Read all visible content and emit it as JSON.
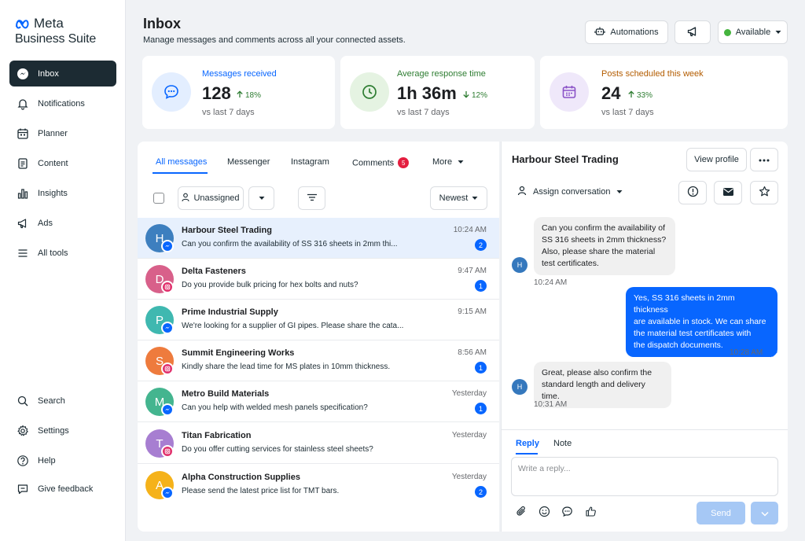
{
  "brand": {
    "meta": "Meta",
    "suite": "Business Suite"
  },
  "sidebar": {
    "items": [
      {
        "label": "Inbox",
        "icon": "messenger-icon"
      },
      {
        "label": "Notifications",
        "icon": "bell-icon"
      },
      {
        "label": "Planner",
        "icon": "calendar-icon"
      },
      {
        "label": "Content",
        "icon": "document-icon"
      },
      {
        "label": "Insights",
        "icon": "bar-chart-icon"
      },
      {
        "label": "Ads",
        "icon": "megaphone-icon"
      },
      {
        "label": "All tools",
        "icon": "menu-icon"
      }
    ],
    "bottom": [
      {
        "label": "Search",
        "icon": "search-icon"
      },
      {
        "label": "Settings",
        "icon": "gear-icon"
      },
      {
        "label": "Help",
        "icon": "help-icon"
      },
      {
        "label": "Give feedback",
        "icon": "feedback-icon"
      }
    ]
  },
  "header": {
    "title": "Inbox",
    "subtitle": "Manage messages and comments across all your connected assets.",
    "automations": "Automations",
    "status": "Available"
  },
  "stats": [
    {
      "label": "Messages received",
      "value": "128",
      "change": "18%",
      "direction": "up",
      "foot": "vs last 7 days",
      "color": "#0866ff"
    },
    {
      "label": "Average response time",
      "value": "1h 36m",
      "change": "12%",
      "direction": "down",
      "foot": "vs last 7 days",
      "color": "#2e7d32"
    },
    {
      "label": "Posts scheduled this week",
      "value": "24",
      "change": "33%",
      "direction": "up",
      "foot": "vs last 7 days",
      "color": "#b35c00"
    }
  ],
  "list": {
    "tabs": [
      "All messages",
      "Messenger",
      "Instagram",
      "Comments",
      "More"
    ],
    "comments_count": "5",
    "unassigned": "Unassigned",
    "sort": "Newest",
    "rows": [
      {
        "initial": "H",
        "name": "Harbour Steel Trading",
        "preview": "Can you confirm the availability of SS 316 sheets in 2mm thi...",
        "time": "10:24 AM",
        "count": "2",
        "channel": "messenger",
        "color": "#3d7fbf"
      },
      {
        "initial": "D",
        "name": "Delta Fasteners",
        "preview": "Do you provide bulk pricing for hex bolts and nuts?",
        "time": "9:47 AM",
        "count": "1",
        "channel": "instagram",
        "color": "#d8608a"
      },
      {
        "initial": "P",
        "name": "Prime Industrial Supply",
        "preview": "We're looking for a supplier of GI pipes. Please share the cata...",
        "time": "9:15 AM",
        "count": "",
        "channel": "messenger",
        "color": "#3fb8b0"
      },
      {
        "initial": "S",
        "name": "Summit Engineering Works",
        "preview": "Kindly share the lead time for MS plates in 10mm thickness.",
        "time": "8:56 AM",
        "count": "1",
        "channel": "instagram",
        "color": "#ee7b3d"
      },
      {
        "initial": "M",
        "name": "Metro Build Materials",
        "preview": "Can you help with welded mesh panels specification?",
        "time": "Yesterday",
        "count": "1",
        "channel": "messenger",
        "color": "#44b58f"
      },
      {
        "initial": "T",
        "name": "Titan Fabrication",
        "preview": "Do you offer cutting services for stainless steel sheets?",
        "time": "Yesterday",
        "count": "",
        "channel": "instagram",
        "color": "#a77ed1"
      },
      {
        "initial": "A",
        "name": "Alpha Construction Supplies",
        "preview": "Please send the latest price list for TMT bars.",
        "time": "Yesterday",
        "count": "2",
        "channel": "messenger",
        "color": "#f5b21a"
      }
    ]
  },
  "conversation": {
    "title": "Harbour Steel Trading",
    "view_profile": "View profile",
    "assign": "Assign conversation",
    "messages": [
      {
        "from": "in",
        "lines": [
          "Can you confirm the availability of",
          "SS 316 sheets in 2mm thickness?",
          "Also, please share the material",
          "test certificates."
        ],
        "time": "10:24 AM"
      },
      {
        "from": "out",
        "lines": [
          "Yes, SS 316 sheets in 2mm thickness",
          "are available in stock. We can share",
          "the material test certificates with",
          "the dispatch documents."
        ],
        "time": "10:28 AM"
      },
      {
        "from": "in",
        "lines": [
          "Great, please also confirm the",
          "standard length and delivery time."
        ],
        "time": "10:31 AM"
      }
    ],
    "avatar_initial": "H",
    "reply_tab": "Reply",
    "note_tab": "Note",
    "placeholder": "Write a reply...",
    "send": "Send"
  }
}
